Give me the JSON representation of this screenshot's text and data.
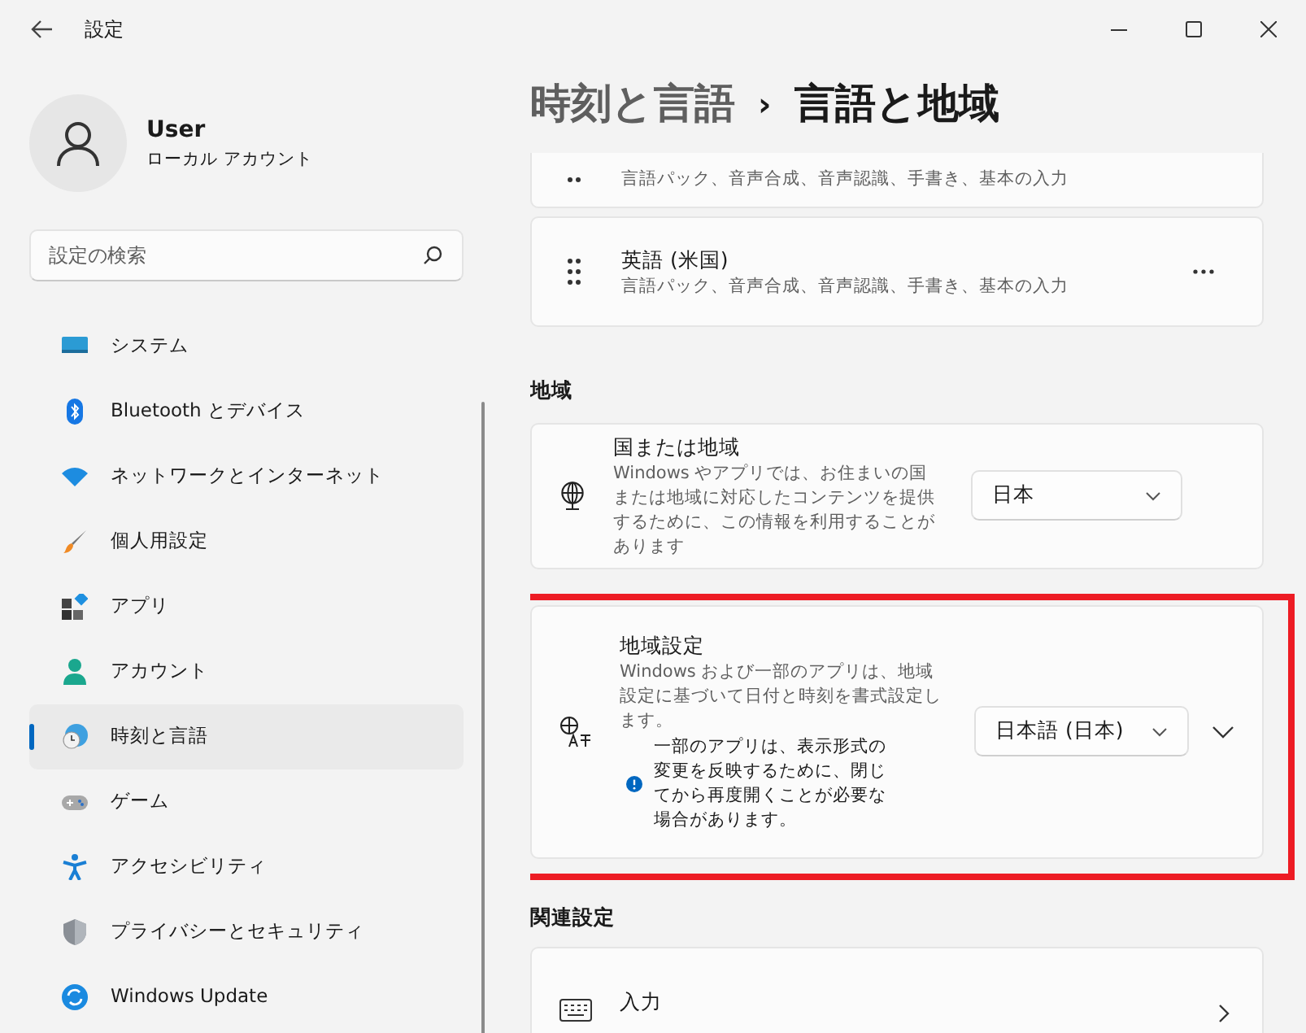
{
  "window": {
    "title": "設定"
  },
  "account": {
    "name": "User",
    "type": "ローカル アカウント"
  },
  "search": {
    "placeholder": "設定の検索"
  },
  "nav": [
    {
      "label": "システム",
      "selected": false
    },
    {
      "label": "Bluetooth とデバイス",
      "selected": false
    },
    {
      "label": "ネットワークとインターネット",
      "selected": false
    },
    {
      "label": "個人用設定",
      "selected": false
    },
    {
      "label": "アプリ",
      "selected": false
    },
    {
      "label": "アカウント",
      "selected": false
    },
    {
      "label": "時刻と言語",
      "selected": true
    },
    {
      "label": "ゲーム",
      "selected": false
    },
    {
      "label": "アクセシビリティ",
      "selected": false
    },
    {
      "label": "プライバシーとセキュリティ",
      "selected": false
    },
    {
      "label": "Windows Update",
      "selected": false
    }
  ],
  "breadcrumb": {
    "parent": "時刻と言語",
    "separator": "›",
    "current": "言語と地域"
  },
  "languages": [
    {
      "subtitle": "言語パック、音声合成、音声認識、手書き、基本の入力"
    },
    {
      "title": "英語 (米国)",
      "subtitle": "言語パック、音声合成、音声認識、手書き、基本の入力"
    }
  ],
  "sections": [
    {
      "heading": "地域",
      "cards": [
        {
          "kind": "dropdown",
          "title": "国または地域",
          "description": "Windows やアプリでは、お住まいの国または地域に対応したコンテンツを提供するために、この情報を利用することがあります",
          "value": "日本",
          "highlighted": false
        },
        {
          "kind": "expander",
          "title": "地域設定",
          "description": "Windows および一部のアプリは、地域設定に基づいて日付と時刻を書式設定します。",
          "note": "一部のアプリは、表示形式の変更を反映するために、閉じてから再度開くことが必要な場合があります。",
          "value": "日本語 (日本)",
          "highlighted": true
        }
      ]
    },
    {
      "heading": "関連設定",
      "cards": [
        {
          "kind": "link",
          "title": "入力",
          "highlighted": false
        }
      ]
    }
  ]
}
